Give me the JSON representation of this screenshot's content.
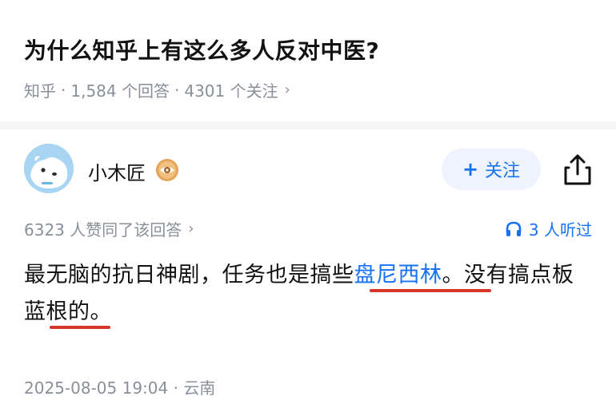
{
  "question": {
    "title": "为什么知乎上有这么多人反对中医?",
    "source": "知乎",
    "answer_count": "1,584 个回答",
    "follower_count": "4301 个关注",
    "chevron": "›"
  },
  "author": {
    "name": "小木匠",
    "badge_icon": "eye-badge-icon",
    "follow_label": "关注",
    "follow_icon": "plus-icon",
    "share_icon": "share-icon"
  },
  "stats": {
    "voteup_text": "6323 人赞同了该回答",
    "listen_text": "3 人听过",
    "listen_icon": "headphones-icon"
  },
  "answer": {
    "text_part1": "最无脑的抗日神剧，任务也是搞些",
    "link_text": "盘尼西林",
    "text_part2": "。没有搞点板蓝根的。",
    "link_color": "#1772f6",
    "annotation_color": "#d7342a"
  },
  "footer": {
    "timestamp": "2025-08-05 19:04",
    "location": "云南"
  }
}
